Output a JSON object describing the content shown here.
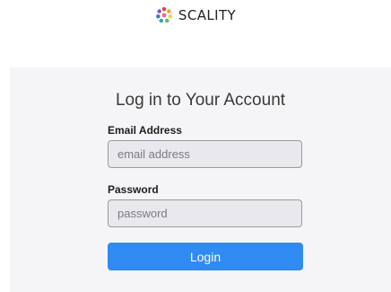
{
  "brand": {
    "name": "SCALITY",
    "logo_icon": "scality-logo-icon"
  },
  "login": {
    "title": "Log in to Your Account",
    "email_label": "Email Address",
    "email_placeholder": "email address",
    "email_value": "",
    "password_label": "Password",
    "password_placeholder": "password",
    "password_value": "",
    "submit_label": "Login"
  },
  "colors": {
    "accent": "#2f8bf2",
    "panel_background": "#f5f5f7",
    "field_background": "#e9e8ec"
  }
}
